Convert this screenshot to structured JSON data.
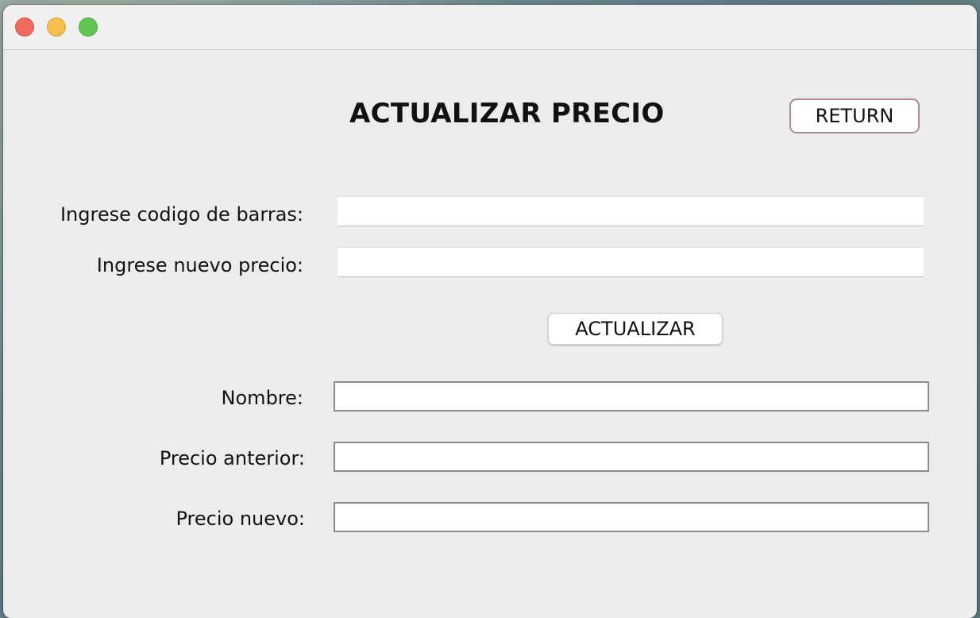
{
  "window": {
    "controls": {
      "close_icon": "close-traffic-light",
      "minimize_icon": "minimize-traffic-light",
      "zoom_icon": "zoom-traffic-light"
    }
  },
  "form": {
    "title": "ACTUALIZAR PRECIO",
    "return_label": "RETURN",
    "barcode_label": "Ingrese codigo de barras:",
    "barcode_value": "",
    "new_price_label": "Ingrese nuevo precio:",
    "new_price_value": "",
    "update_label": "ACTUALIZAR"
  },
  "result": {
    "name_label": "Nombre:",
    "name_value": "",
    "previous_price_label": "Precio anterior:",
    "previous_price_value": "",
    "new_price_label": "Precio nuevo:",
    "new_price_value": ""
  },
  "colors": {
    "window_background": "#ececec",
    "close": "#ee6a5f",
    "minimize": "#f5be4f",
    "zoom": "#62c554",
    "return_border": "#a88b90"
  }
}
